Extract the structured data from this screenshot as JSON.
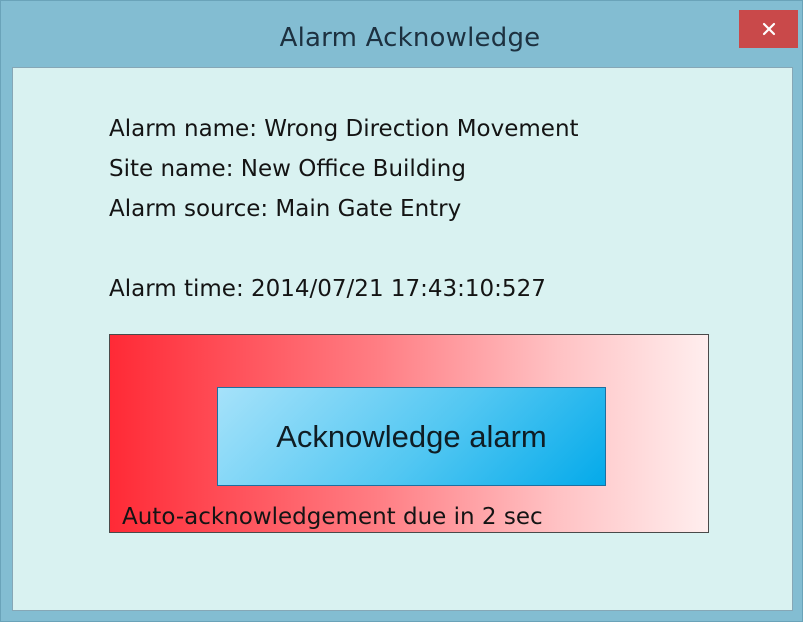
{
  "window": {
    "title": "Alarm Acknowledge",
    "close_icon": "close-icon"
  },
  "alarm": {
    "name_line": "Alarm name: Wrong Direction Movement",
    "site_line": "Site name: New Office Building",
    "source_line": "Alarm source: Main Gate Entry",
    "time_line": "Alarm time: 2014/07/21 17:43:10:527"
  },
  "panel": {
    "button_label": "Acknowledge alarm",
    "countdown_text": "Auto-acknowledgement due in 2 sec"
  },
  "colors": {
    "frame": "#83bdd2",
    "client_bg": "#d9f2f1",
    "close_button": "#c9494a",
    "alarm_red": "#ff2a36",
    "button_blue": "#04aaea"
  }
}
